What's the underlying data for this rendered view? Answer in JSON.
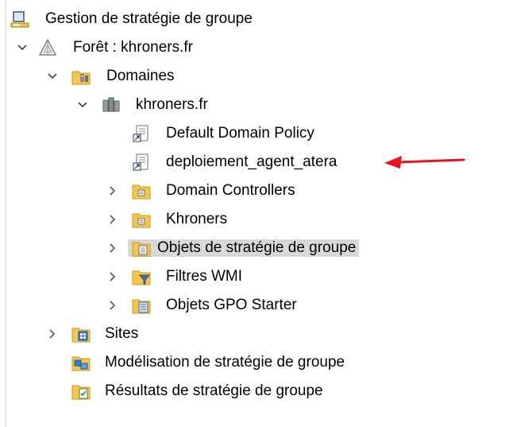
{
  "tree": {
    "items": [
      {
        "label": "Gestion de stratégie de groupe"
      },
      {
        "label": "Forêt : khroners.fr"
      },
      {
        "label": "Domaines"
      },
      {
        "label": "khroners.fr"
      },
      {
        "label": "Default Domain Policy"
      },
      {
        "label": "deploiement_agent_atera"
      },
      {
        "label": "Domain Controllers"
      },
      {
        "label": "Khroners"
      },
      {
        "label": "Objets de stratégie de groupe"
      },
      {
        "label": "Filtres WMI"
      },
      {
        "label": "Objets GPO Starter"
      },
      {
        "label": "Sites"
      },
      {
        "label": "Modélisation de stratégie de groupe"
      },
      {
        "label": "Résultats de stratégie de groupe"
      }
    ],
    "selected_item": "Objets de stratégie de groupe"
  },
  "colors": {
    "selection": "#d9d9d9",
    "annotation_arrow": "#e8141c",
    "folder": "#f3c64e"
  }
}
